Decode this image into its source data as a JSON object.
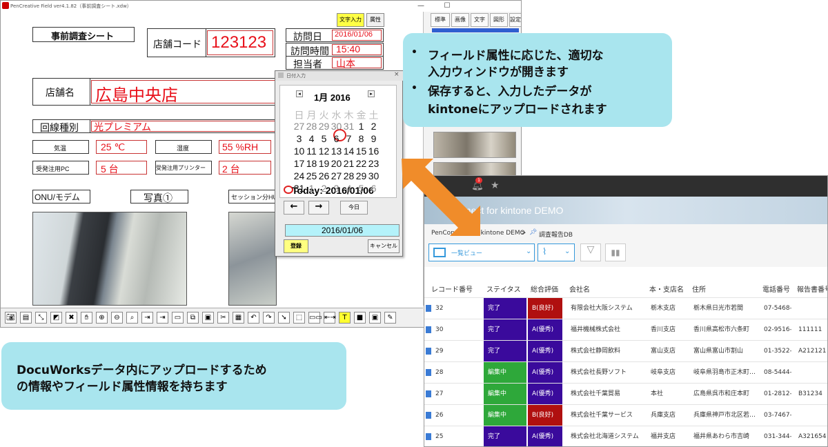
{
  "pencreative": {
    "window_title": "PenCreative Field ver4.1.82（事前調査シート.xdw）",
    "buttons": {
      "text_input": "文字入力",
      "attribute": "属性"
    },
    "right_tabs": [
      "標準",
      "画像",
      "文字",
      "図形",
      "設定"
    ],
    "form": {
      "sheet_title": "事前調査シート",
      "store_code_label": "店舗コード",
      "store_code_value": "123123",
      "visit_date_label": "訪問日",
      "visit_date_value": "2016/01/06",
      "visit_time_label": "訪問時間",
      "visit_time_value": "15:40",
      "person_label": "担当者",
      "person_value": "山本",
      "store_name_label": "店舗名",
      "store_name_value": "広島中央店",
      "line_type_label": "回線種別",
      "line_type_value": "光プレミアム",
      "temp_label": "気温",
      "temp_value": "25 ℃",
      "humidity_label": "湿度",
      "humidity_value": "55 %RH",
      "pc_label": "受発注用PC",
      "pc_value": "5 台",
      "printer_label": "受発注用プリンター",
      "printer_value": "2 台",
      "onu_label": "ONU/モデム",
      "photo_label": "写真①",
      "session_label": "セッション分HU"
    },
    "calendar": {
      "title": "日付入力",
      "month_label": "1月 2016",
      "weekdays": [
        "日",
        "月",
        "火",
        "水",
        "木",
        "金",
        "土"
      ],
      "weeks": [
        [
          "27",
          "28",
          "29",
          "30",
          "31",
          "1",
          "2"
        ],
        [
          "3",
          "4",
          "5",
          "6",
          "7",
          "8",
          "9"
        ],
        [
          "10",
          "11",
          "12",
          "13",
          "14",
          "15",
          "16"
        ],
        [
          "17",
          "18",
          "19",
          "20",
          "21",
          "22",
          "23"
        ],
        [
          "24",
          "25",
          "26",
          "27",
          "28",
          "29",
          "30"
        ],
        [
          "31",
          "1",
          "2",
          "3",
          "4",
          "5",
          "6"
        ]
      ],
      "today_label": "Today:  2016/01/06",
      "prev_btn": "←",
      "next_btn": "→",
      "today_btn": "今日",
      "selected_date": "2016/01/06",
      "register_btn": "登録",
      "cancel_btn": "キャンセル"
    }
  },
  "callouts": {
    "top_lines": [
      "フィールド属性に応じた、適切な",
      "入力ウィンドウが開きます",
      "保存すると、入力したデータが",
      "kintoneにアップロードされます"
    ],
    "bottom_lines": [
      "DocuWorksデータ内にアップロードするため",
      "の情報やフィールド属性情報を持ちます"
    ]
  },
  "kintone": {
    "notification_count": "1",
    "app_title": "PenConnect for kintone DEMO",
    "app_title_visible": "nnect for kintone DEMO",
    "breadcrumb": [
      "PenConnect for kintone DEMO",
      ">",
      "調査報告DB"
    ],
    "view_name": "一覧ビュー",
    "columns": [
      "レコード番号",
      "ステイタス",
      "総合評価",
      "会社名",
      "本・支店名",
      "住所",
      "電話番号",
      "報告書番号"
    ],
    "rows": [
      {
        "id": "32",
        "status": "完了",
        "rating": "B(良好)",
        "company": "有限会社大阪システム",
        "branch": "栃木支店",
        "address": "栃木県日光市若間",
        "phone": "07-5468-…",
        "report": ""
      },
      {
        "id": "30",
        "status": "完了",
        "rating": "A(優秀)",
        "company": "福井機械株式会社",
        "branch": "香川支店",
        "address": "香川県高松市六条町",
        "phone": "02-9516-…",
        "report": "111111"
      },
      {
        "id": "29",
        "status": "完了",
        "rating": "A(優秀)",
        "company": "株式会社静岡飲料",
        "branch": "富山支店",
        "address": "富山県富山市割山",
        "phone": "01-3522-…",
        "report": "A212121"
      },
      {
        "id": "28",
        "status": "編集中",
        "rating": "A(優秀)",
        "company": "株式会社長野ソフト",
        "branch": "岐阜支店",
        "address": "岐阜県羽島市正木町…",
        "phone": "08-5444-…",
        "report": ""
      },
      {
        "id": "27",
        "status": "編集中",
        "rating": "A(優秀)",
        "company": "株式会社千葉貿易",
        "branch": "本社",
        "address": "広島県呉市和庄本町",
        "phone": "01-2812-…",
        "report": "B31234"
      },
      {
        "id": "26",
        "status": "編集中",
        "rating": "B(良好)",
        "company": "株式会社千葉サービス",
        "branch": "兵庫支店",
        "address": "兵庫県神戸市北区若…",
        "phone": "03-7467-…",
        "report": ""
      },
      {
        "id": "25",
        "status": "完了",
        "rating": "A(優秀)",
        "company": "株式会社北海道システム",
        "branch": "福井支店",
        "address": "福井県あわら市吉崎",
        "phone": "031-344-…",
        "report": "A321654"
      }
    ]
  },
  "colors": {
    "status_done": "#3a0a9c",
    "status_editing": "#2ea83a",
    "rating_good": "#b01010",
    "rating_excellent": "#3a0a9c",
    "form_value_red": "#e8101a",
    "callout_bg": "#a9e5ee",
    "arrow_orange": "#f08c2a"
  }
}
